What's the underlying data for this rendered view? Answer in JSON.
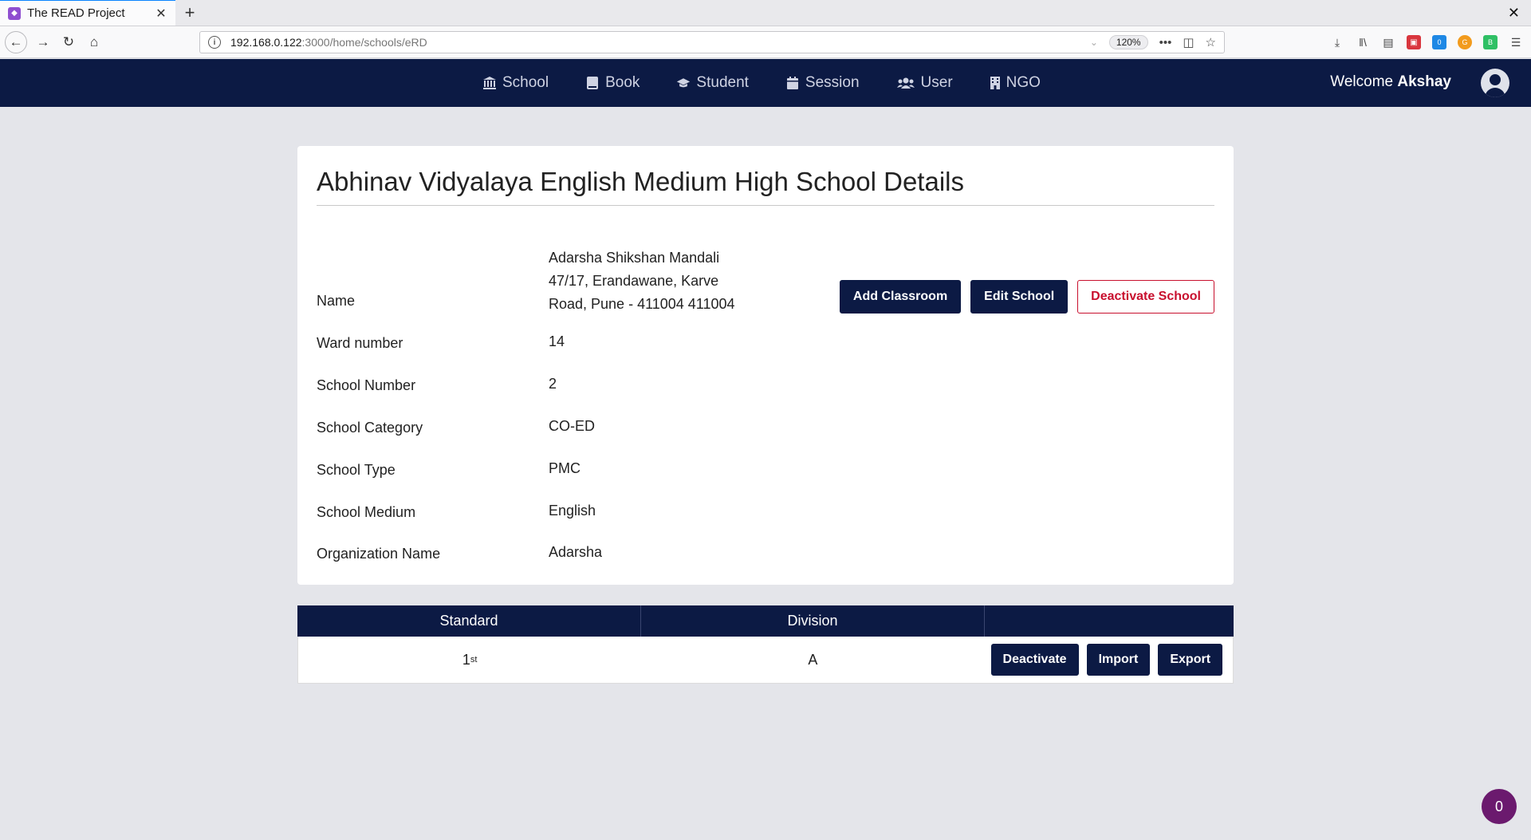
{
  "browser": {
    "tab_title": "The READ Project",
    "url_host": "192.168.0.122",
    "url_path": ":3000/home/schools/eRD",
    "zoom": "120%",
    "badge_count": "0"
  },
  "header": {
    "menu": [
      {
        "label": "School",
        "icon": "bank-icon"
      },
      {
        "label": "Book",
        "icon": "book-icon"
      },
      {
        "label": "Student",
        "icon": "graduation-cap-icon"
      },
      {
        "label": "Session",
        "icon": "calendar-icon"
      },
      {
        "label": "User",
        "icon": "users-icon"
      },
      {
        "label": "NGO",
        "icon": "building-icon"
      }
    ],
    "welcome_prefix": "Welcome",
    "username": "Akshay"
  },
  "details": {
    "title": "Abhinav Vidyalaya English Medium High School Details",
    "fields": [
      {
        "label": "Name",
        "value_lines": [
          "Adarsha Shikshan Mandali",
          "47/17, Erandawane, Karve",
          "Road, Pune - 411004 411004"
        ]
      },
      {
        "label": "Ward number",
        "value": "14"
      },
      {
        "label": "School Number",
        "value": "2"
      },
      {
        "label": "School Category",
        "value": "CO-ED"
      },
      {
        "label": "School Type",
        "value": "PMC"
      },
      {
        "label": "School Medium",
        "value": "English"
      },
      {
        "label": "Organization Name",
        "value": "Adarsha"
      }
    ],
    "buttons": {
      "add_classroom": "Add Classroom",
      "edit_school": "Edit School",
      "deactivate_school": "Deactivate School"
    }
  },
  "classrooms": {
    "columns": [
      "Standard",
      "Division",
      ""
    ],
    "rows": [
      {
        "standard_num": "1",
        "standard_suffix": "st",
        "division": "A",
        "actions": [
          "Deactivate",
          "Import",
          "Export"
        ]
      }
    ]
  },
  "floating_badge": "0"
}
